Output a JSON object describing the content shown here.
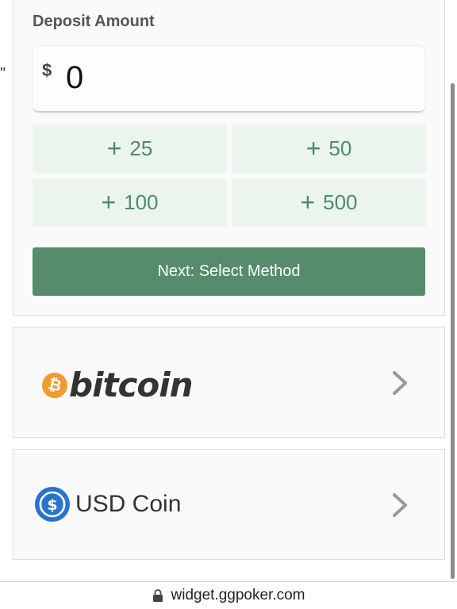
{
  "stray_mark": "\"",
  "deposit": {
    "title": "Deposit Amount",
    "currency_symbol": "$",
    "amount_value": "0",
    "quick_amounts": [
      "25",
      "50",
      "100",
      "500"
    ],
    "quick_prefix_icon": "plus-icon",
    "next_label": "Next: Select Method"
  },
  "methods": {
    "bitcoin": {
      "logo_text": "bitcoin",
      "icon": "bitcoin-icon",
      "coin_glyph": "₿"
    },
    "usdc": {
      "logo_text": "USD Coin",
      "icon": "usdc-icon"
    },
    "chevron_icon": "chevron-right-icon"
  },
  "browser": {
    "url": "widget.ggpoker.com",
    "lock_icon": "lock-icon"
  },
  "colors": {
    "accent_green": "#568c6b",
    "quick_bg": "#ebf5ee",
    "quick_text": "#4f8a67",
    "bitcoin_orange": "#f29a2f",
    "usdc_blue": "#2775ca"
  }
}
